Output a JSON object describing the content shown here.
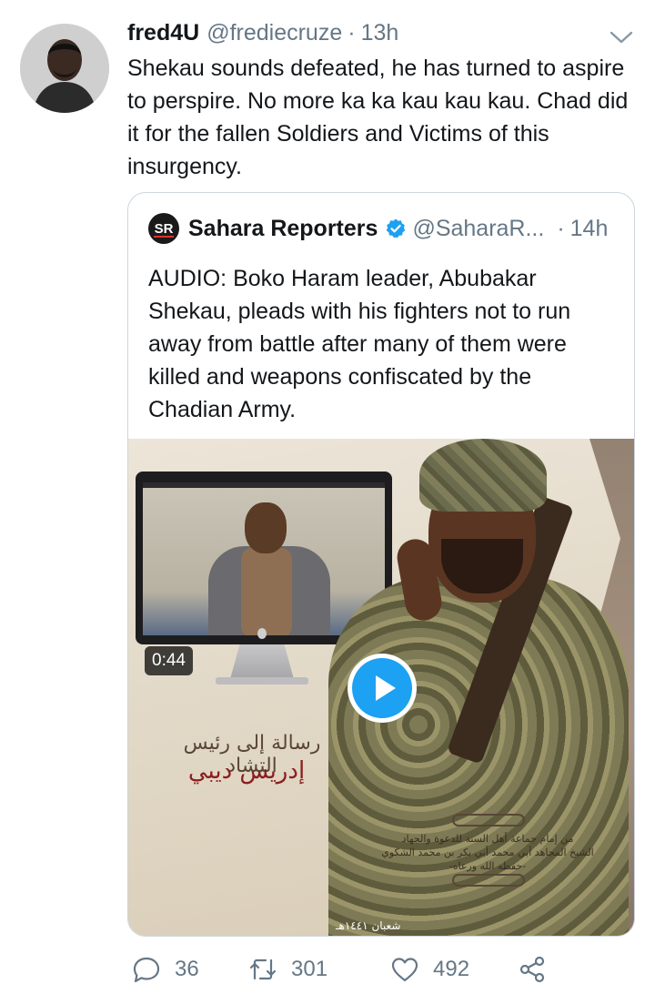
{
  "tweet": {
    "author_name": "fred4U",
    "author_handle": "@frediecruze",
    "separator": "·",
    "time": "13h",
    "text": "Shekau sounds defeated, he has turned to aspire to perspire. No more ka ka kau kau kau. Chad did it for the fallen Soldiers and Victims of this insurgency.",
    "menu_icon": "chevron-down-icon"
  },
  "quoted": {
    "logo_text": "SR",
    "author_name": "Sahara Reporters",
    "verified_icon": "verified-badge-icon",
    "author_handle": "@SaharaR...",
    "separator": "·",
    "time": "14h",
    "text": "AUDIO: Boko Haram leader, Abubakar Shekau, pleads with his fighters not to run away from battle after many of them were killed and weapons confiscated by the Chadian Army.",
    "media": {
      "type": "video",
      "duration": "0:44",
      "poster_text": {
        "line1": "رسالة إلى رئيس التشاد",
        "line2": "إدريس ديبي",
        "credit_line1": "من إمام جماعة أهل السنة للدعوة والجهاد",
        "credit_line2": "الشيخ المجاهد أبي محمد أبي بكر بن محمد الشكوي",
        "credit_line3": "-حفظه الله ورعاه-",
        "date": "شعبان ١٤٤١هـ"
      }
    }
  },
  "actions": {
    "reply_count": "36",
    "retweet_count": "301",
    "like_count": "492",
    "colors": {
      "icon": "#657786",
      "accent": "#1da1f2"
    }
  }
}
